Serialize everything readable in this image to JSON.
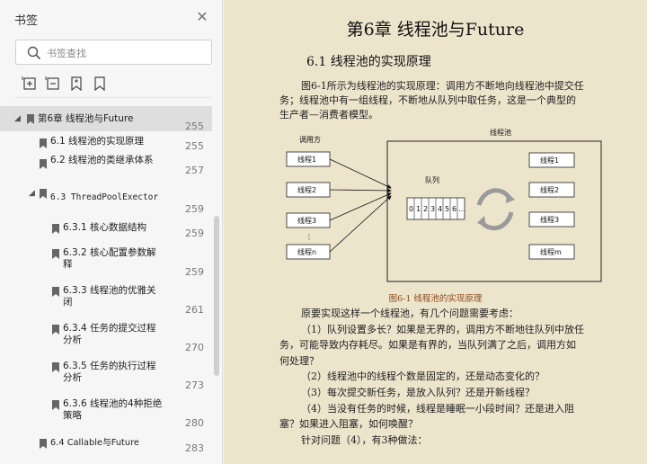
{
  "sidebar": {
    "title": "书签",
    "search_placeholder": "书签查找",
    "toc": [
      {
        "label": "第6章  线程池与Future",
        "page": "255"
      },
      {
        "label": "6.1  线程池的实现原理",
        "page": "255"
      },
      {
        "label": "6.2  线程池的类继承体系",
        "page": "257"
      },
      {
        "label": "6.3  ThreadPoolExector",
        "page": "259"
      },
      {
        "label": "6.3.1  核心数据结构",
        "page": "259"
      },
      {
        "label": "6.3.2  核心配置参数解释",
        "page": "259"
      },
      {
        "label": "6.3.3  线程池的优雅关闭",
        "page": "261"
      },
      {
        "label": "6.3.4  任务的提交过程分析",
        "page": "270"
      },
      {
        "label": "6.3.5  任务的执行过程分析",
        "page": "273"
      },
      {
        "label": "6.3.6  线程池的4种拒绝策略",
        "page": "280"
      },
      {
        "label": "6.4  Callable与Future",
        "page": "283"
      }
    ]
  },
  "page": {
    "chapter_title": "第6章   线程池与Future",
    "section_title": "6.1  线程池的实现原理",
    "intro": [
      "图6-1所示为线程池的实现原理：调用方不断地向线程池中提交任",
      "务；线程池中有一组线程，不断地从队列中取任务，这是一个典型的",
      "生产者—消费者模型。"
    ],
    "figure": {
      "caller_label": "调用方",
      "pool_label": "线程池",
      "queue_label": "队列",
      "callers": [
        "线程1",
        "线程2",
        "线程3",
        "线程n"
      ],
      "workers": [
        "线程1",
        "线程2",
        "线程3",
        "线程m"
      ],
      "queue_cells": [
        "0",
        "1",
        "2",
        "3",
        "4",
        "5",
        "6",
        "…"
      ],
      "ellipsis": "⋮"
    },
    "caption": "图6-1  线程池的实现原理",
    "body": [
      "原要实现这样一个线程池，有几个问题需要考虑：",
      "（1）队列设置多长？如果是无界的，调用方不断地往队列中放任",
      "务，可能导致内存耗尽。如果是有界的，当队列满了之后，调用方如",
      "何处理？",
      "（2）线程池中的线程个数是固定的，还是动态变化的？",
      "（3）每次提交新任务，是放入队列？还是开新线程？",
      "（4）当没有任务的时候，线程是睡眠一小段时间？还是进入阻",
      "塞？如果进入阻塞，如何唤醒？",
      "针对问题（4），有3种做法："
    ]
  }
}
